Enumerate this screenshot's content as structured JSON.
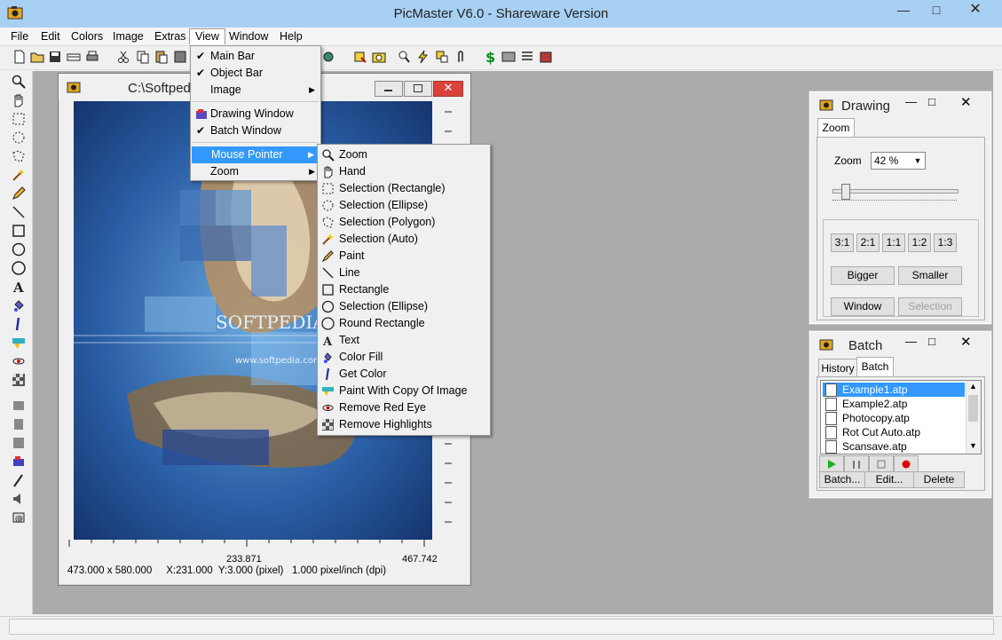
{
  "app": {
    "title": "PicMaster V6.0 - Shareware Version"
  },
  "menubar": {
    "items": [
      "File",
      "Edit",
      "Colors",
      "Image",
      "Extras",
      "View",
      "Window",
      "Help"
    ]
  },
  "view_menu": {
    "items": [
      {
        "label": "Main Bar",
        "checked": true
      },
      {
        "label": "Object Bar",
        "checked": true
      },
      {
        "label": "Image",
        "submenu": true
      },
      {
        "label": "Drawing Window"
      },
      {
        "label": "Batch Window",
        "checked": true
      },
      {
        "label": "Mouse Pointer",
        "submenu": true,
        "highlighted": true
      },
      {
        "label": "Zoom",
        "submenu": true
      }
    ]
  },
  "pointer_menu": {
    "items": [
      {
        "label": "Zoom",
        "icon": "magnifier-icon"
      },
      {
        "label": "Hand",
        "icon": "hand-icon"
      },
      {
        "label": "Selection (Rectangle)",
        "icon": "rect-select-icon"
      },
      {
        "label": "Selection (Ellipse)",
        "icon": "ellipse-select-icon"
      },
      {
        "label": "Selection (Polygon)",
        "icon": "polygon-select-icon"
      },
      {
        "label": "Selection (Auto)",
        "icon": "magic-wand-icon"
      },
      {
        "label": "Paint",
        "icon": "pencil-icon"
      },
      {
        "label": "Line",
        "icon": "line-icon"
      },
      {
        "label": "Rectangle",
        "icon": "rectangle-icon"
      },
      {
        "label": "Selection (Ellipse)",
        "icon": "ellipse-icon"
      },
      {
        "label": "Round Rectangle",
        "icon": "round-rectangle-icon"
      },
      {
        "label": "Text",
        "icon": "text-icon"
      },
      {
        "label": "Color Fill",
        "icon": "fill-bucket-icon"
      },
      {
        "label": "Get Color",
        "icon": "eyedropper-icon"
      },
      {
        "label": "Paint With Copy Of Image",
        "icon": "clone-brush-icon"
      },
      {
        "label": "Remove Red Eye",
        "icon": "red-eye-icon"
      },
      {
        "label": "Remove Highlights",
        "icon": "highlights-icon"
      }
    ]
  },
  "image_window": {
    "title": "C:\\Softpedia",
    "title_tail": "g",
    "ruler_labels": [
      "233.871",
      "467.742"
    ],
    "status": "473.000 x 580.000     X:231.000  Y:3.000 (pixel)   1.000 pixel/inch (dpi)",
    "watermark": "SOFTPEDIA",
    "watermark_url": "www.softpedia.com"
  },
  "drawing_panel": {
    "title": "Drawing",
    "tab": "Zoom",
    "zoom_label": "Zoom",
    "zoom_value": "42 %",
    "zoom_slider_fraction": 0.1,
    "ratio_buttons": [
      "3:1",
      "2:1",
      "1:1",
      "1:2",
      "1:3"
    ],
    "bigger": "Bigger",
    "smaller": "Smaller",
    "window": "Window",
    "selection": "Selection"
  },
  "batch_panel": {
    "title": "Batch",
    "tabs": [
      "History",
      "Batch"
    ],
    "files": [
      "Example1.atp",
      "Example2.atp",
      "Photocopy.atp",
      "Rot Cut Auto.atp",
      "Scansave.atp"
    ],
    "batch_btn": "Batch...",
    "edit_btn": "Edit...",
    "delete_btn": "Delete"
  },
  "colors": {
    "highlight": "#3399ff",
    "titlebar": "#a7d0f3",
    "workspace": "#ababab"
  }
}
